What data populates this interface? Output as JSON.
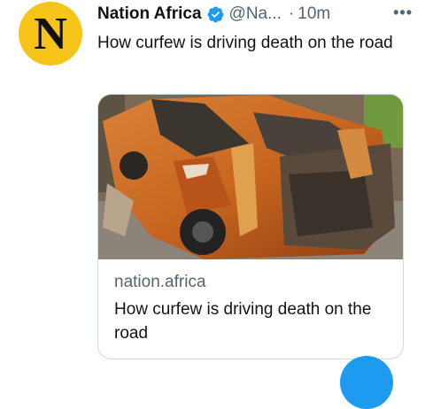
{
  "tweet": {
    "avatar_letter": "N",
    "author_name": "Nation Africa",
    "handle": "@Na...",
    "separator": "·",
    "time": "10m",
    "more_label": "•••",
    "text": "How curfew is driving death on the road"
  },
  "card": {
    "image_icon": "crashed-vehicle-photo",
    "domain": "nation.africa",
    "title": "How curfew is driving death on the road"
  },
  "colors": {
    "avatar": "#f7c51a",
    "verified": "#1d9bf0",
    "accent": "#1d9bf0",
    "secondary_text": "#536471"
  }
}
